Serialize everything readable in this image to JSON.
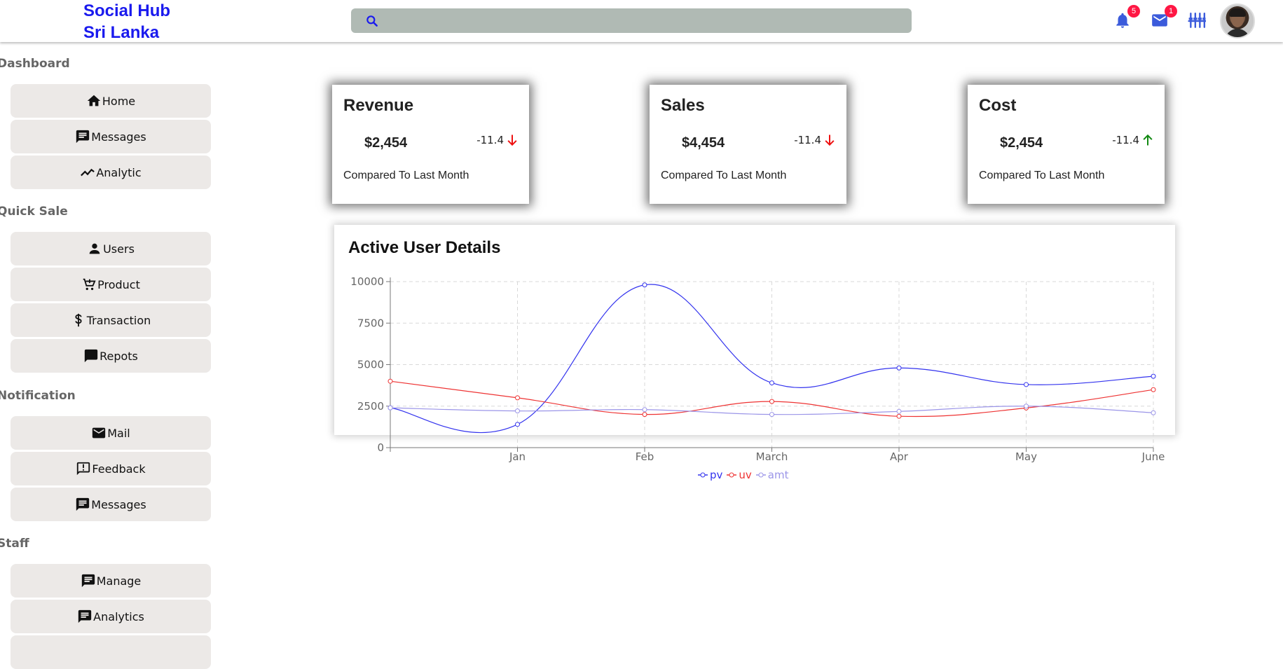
{
  "app": {
    "title_line1": "Social Hub",
    "title_line2": "Sri Lanka"
  },
  "header": {
    "search_placeholder": "",
    "notifications_count": "5",
    "messages_count": "1",
    "icons": [
      "search-icon",
      "bell-icon",
      "mail-icon",
      "settings-sliders-icon",
      "avatar"
    ]
  },
  "sidebar": {
    "sections": [
      {
        "title": "Dashboard",
        "items": [
          {
            "label": "Home",
            "icon": "home-icon"
          },
          {
            "label": "Messages",
            "icon": "message-icon"
          },
          {
            "label": "Analytic",
            "icon": "trending-icon"
          }
        ]
      },
      {
        "title": "Quick Sale",
        "items": [
          {
            "label": "Users",
            "icon": "person-icon"
          },
          {
            "label": "Product",
            "icon": "cart-icon"
          },
          {
            "label": "Transaction",
            "icon": "dollar-icon"
          },
          {
            "label": "Repots",
            "icon": "chat-icon"
          }
        ]
      },
      {
        "title": "Notification",
        "items": [
          {
            "label": "Mail",
            "icon": "mail-icon"
          },
          {
            "label": "Feedback",
            "icon": "feedback-icon"
          },
          {
            "label": "Messages",
            "icon": "message-icon"
          }
        ]
      },
      {
        "title": "Staff",
        "items": [
          {
            "label": "Manage",
            "icon": "message-icon"
          },
          {
            "label": "Analytics",
            "icon": "message-icon"
          }
        ]
      }
    ]
  },
  "cards": [
    {
      "title": "Revenue",
      "value": "$2,454",
      "rate": "-11.4",
      "trend": "down",
      "subtitle": "Compared To Last Month"
    },
    {
      "title": "Sales",
      "value": "$4,454",
      "rate": "-11.4",
      "trend": "down",
      "subtitle": "Compared To Last Month"
    },
    {
      "title": "Cost",
      "value": "$2,454",
      "rate": "-11.4",
      "trend": "up",
      "subtitle": "Compared To Last Month"
    }
  ],
  "colors": {
    "down": "#ee1111",
    "up": "#118811",
    "accent": "#1a1aee",
    "pv": "#3333ee",
    "uv": "#ee3333",
    "amt": "#9b95e8"
  },
  "chart": {
    "title": "Active User Details"
  },
  "chart_data": {
    "type": "line",
    "title": "Active User Details",
    "categories": [
      "",
      "Jan",
      "Feb",
      "March",
      "Apr",
      "May",
      "June"
    ],
    "series": [
      {
        "name": "pv",
        "values": [
          2400,
          1400,
          9800,
          3900,
          4800,
          3800,
          4300
        ]
      },
      {
        "name": "uv",
        "values": [
          4000,
          3000,
          2000,
          2780,
          1890,
          2390,
          3490
        ]
      },
      {
        "name": "amt",
        "values": [
          2400,
          2210,
          2290,
          2000,
          2181,
          2500,
          2100
        ]
      }
    ],
    "yticks": [
      0,
      2500,
      5000,
      7500,
      10000
    ],
    "ylim": [
      0,
      10000
    ],
    "grid": true,
    "legend": "bottom-center"
  }
}
